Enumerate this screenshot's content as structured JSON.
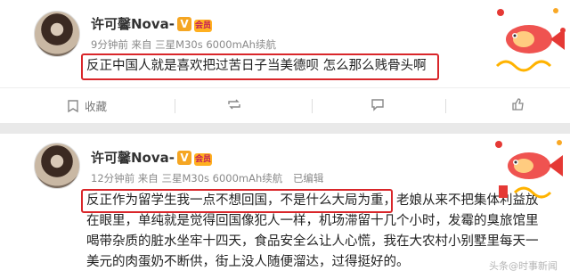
{
  "post1": {
    "username": "许可馨Nova-",
    "verified_mark": "V",
    "vip_mark": "会员",
    "time": "9分钟前",
    "source_prefix": "来自",
    "source": "三星M30s 6000mAh续航",
    "text": "反正中国人就是喜欢把过苦日子当美德呗 怎么那么贱骨头啊",
    "actions": {
      "favorite": "收藏",
      "repost": "",
      "comment": "",
      "like": ""
    }
  },
  "post2": {
    "username": "许可馨Nova-",
    "verified_mark": "V",
    "vip_mark": "会员",
    "time": "12分钟前",
    "source_prefix": "来自",
    "source": "三星M30s 6000mAh续航",
    "edited": "已编辑",
    "text_highlighted": "反正作为留学生我一点不想回国，不是什么大局为重，",
    "text_rest_line1": "老娘从来不把集体利益放",
    "text_line2": "在眼里，单纯就是觉得回国像犯人一样，机场滞留十几个小时，发霉的臭旅馆里",
    "text_line3": "喝带杂质的脏水坐牢十四天，食品安全么让人心慌，我在大农村小别墅里每天一",
    "text_line4": "美元的肉蛋奶不断供，街上没人随便溜达，过得挺好的。"
  },
  "watermark": "头条@时事新闻",
  "colors": {
    "highlight": "#d9262a",
    "badge": "#f5a623",
    "background": "#e9e9e9"
  }
}
